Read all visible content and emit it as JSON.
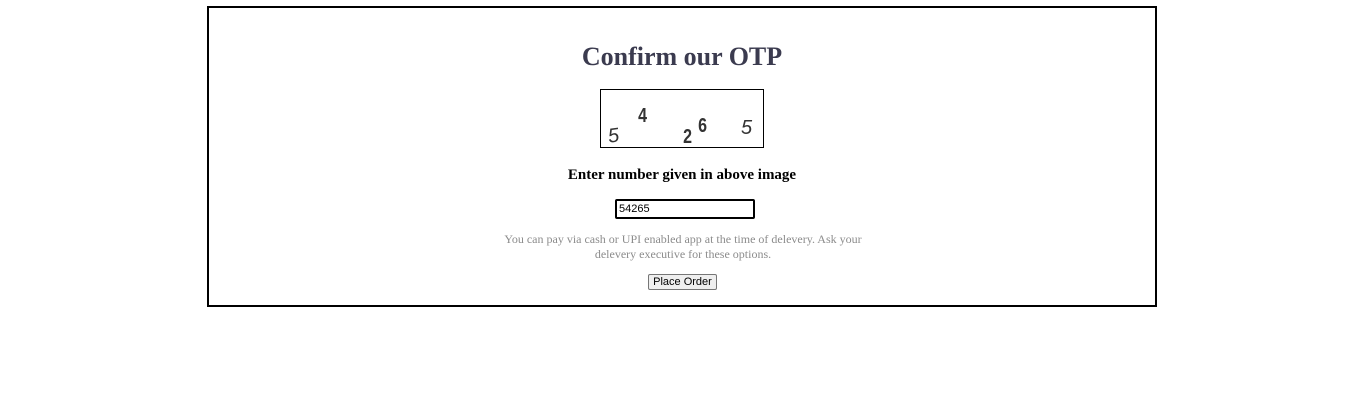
{
  "otp": {
    "title": "Confirm our OTP",
    "captcha_digits": [
      "5",
      "4",
      "2",
      "6",
      "5"
    ],
    "prompt": "Enter number given in above image",
    "input_value": "54265",
    "note": "You can pay via cash or UPI enabled app at the time of delevery. Ask your delevery executive for these options.",
    "place_order_label": "Place Order"
  },
  "colors": {
    "title": "#3b3b4f",
    "note": "#8c8c8c",
    "border": "#000000"
  }
}
